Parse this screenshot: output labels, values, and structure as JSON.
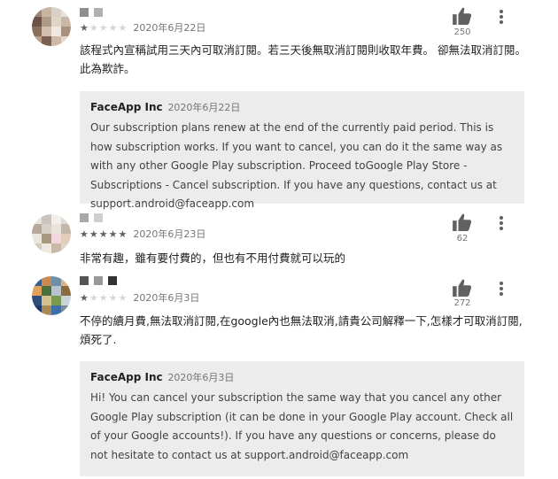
{
  "reviews": [
    {
      "name": "",
      "rating": 1,
      "date": "2020年6月22日",
      "likes": "250",
      "text": "該程式內宣稱試用三天內可取消訂閱。若三天後無取消訂閱則收取年費。 卻無法取消訂閱。 此為欺詐。",
      "reply": {
        "developer": "FaceApp Inc",
        "date": "2020年6月22日",
        "text": "Our subscription plans renew at the end of the currently paid period. This is how subscription works. If you want to cancel, you can do it the same way as with any other Google Play subscription. Proceed toGoogle Play Store - Subscriptions - Cancel subscription. If you have any questions, contact us at support.android@faceapp.com"
      }
    },
    {
      "name": "",
      "rating": 5,
      "date": "2020年6月23日",
      "likes": "62",
      "text": "非常有趣，雖有要付費的，但也有不用付費就可以玩的"
    },
    {
      "name": "",
      "rating": 1,
      "date": "2020年6月3日",
      "likes": "272",
      "text": "不停的續月費,無法取消訂閱,在google內也無法取消,請貴公司解釋一下,怎樣才可取消訂閱,煩死了.",
      "reply": {
        "developer": "FaceApp Inc",
        "date": "2020年6月3日",
        "text": "Hi! You can cancel your subscription the same way that you cancel any other Google Play subscription (it can be done in your Google Play account. Check all of your Google accounts!). If you have any questions or concerns, please do not hesitate to contact us at support.android@faceapp.com"
      }
    }
  ],
  "icons": {
    "thumb": "thumb-up-icon",
    "menu": "more-vert-icon",
    "star": "star-icon"
  },
  "colors": {
    "reply_bg": "#ececec",
    "star_on": "#5f6368",
    "star_off": "#d6d6d6"
  }
}
